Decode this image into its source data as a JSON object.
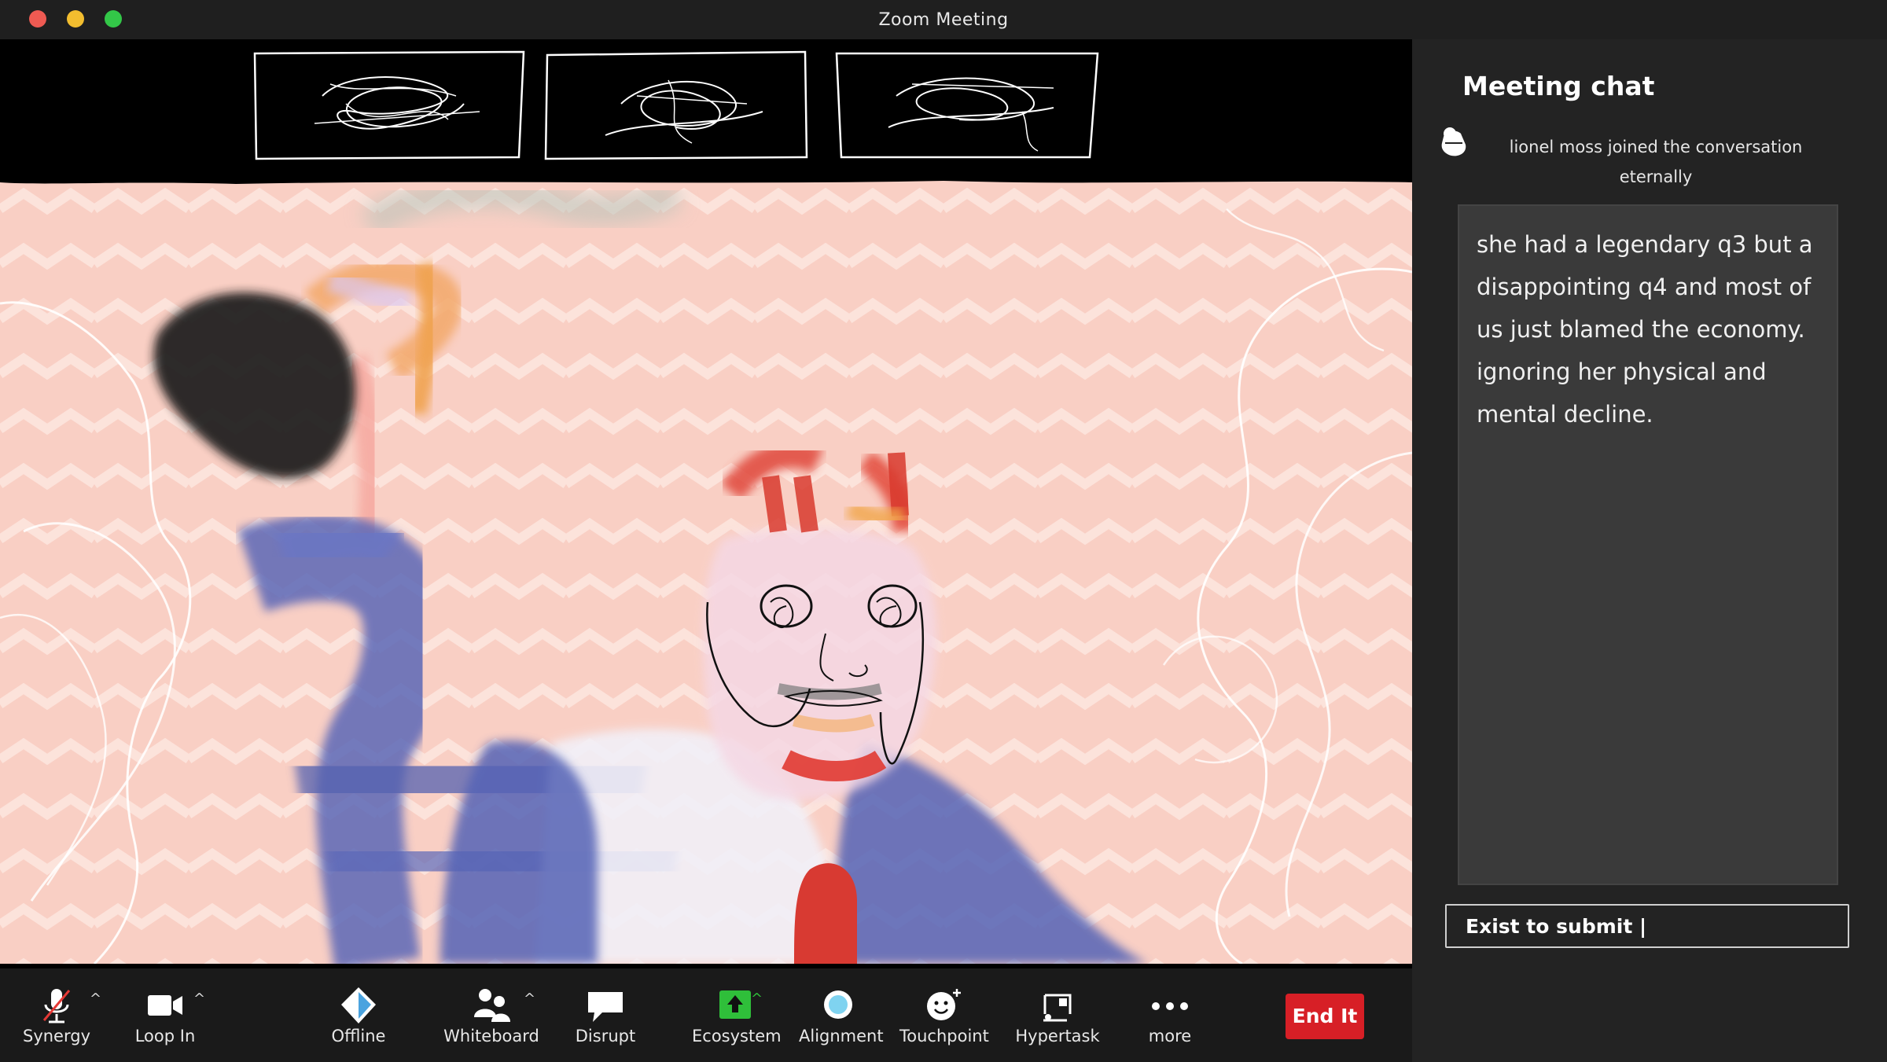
{
  "window": {
    "title": "Zoom Meeting"
  },
  "chat": {
    "title": "Meeting chat",
    "join_message": "lionel moss  joined the conversation eternally",
    "message": "she had a legendary q3 but a disappointing q4 and most of us just blamed the economy. ignoring her physical and mental decline.",
    "input_value": "Exist to submit |"
  },
  "toolbar": {
    "items": [
      {
        "label": "Synergy",
        "icon": "microphone-muted-icon"
      },
      {
        "label": "Loop In",
        "icon": "video-camera-icon"
      },
      {
        "label": "Offline",
        "icon": "diamond-icon"
      },
      {
        "label": "Whiteboard",
        "icon": "participants-icon"
      },
      {
        "label": "Disrupt",
        "icon": "chat-bubble-icon"
      },
      {
        "label": "Ecosystem",
        "icon": "share-screen-icon"
      },
      {
        "label": "Alignment",
        "icon": "record-icon"
      },
      {
        "label": "Touchpoint",
        "icon": "reactions-icon"
      },
      {
        "label": "Hypertask",
        "icon": "apps-icon"
      },
      {
        "label": "more",
        "icon": "more-dots-icon"
      }
    ],
    "end_label": "End It"
  },
  "colors": {
    "end_button": "#d71f26",
    "share_accent": "#2fbf3a",
    "background_pink": "#f9cfc4"
  }
}
